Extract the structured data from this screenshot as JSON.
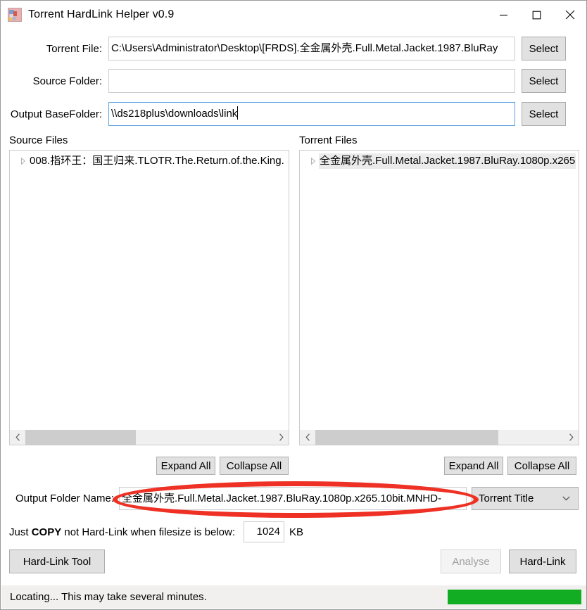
{
  "window": {
    "title": "Torrent HardLink Helper v0.9",
    "icon": "app-icon",
    "controls": {
      "minimize": "minimize-icon",
      "maximize": "maximize-icon",
      "close": "close-icon"
    }
  },
  "form": {
    "torrent_file": {
      "label": "Torrent File:",
      "value": "C:\\Users\\Administrator\\Desktop\\[FRDS].全金属外壳.Full.Metal.Jacket.1987.BluRay",
      "button": "Select"
    },
    "source_folder": {
      "label": "Source Folder:",
      "value": "",
      "button": "Select"
    },
    "output_basefolder": {
      "label": "Output BaseFolder:",
      "value": "\\\\ds218plus\\downloads\\link",
      "button": "Select"
    }
  },
  "panels": {
    "source": {
      "header": "Source Files",
      "items": [
        {
          "label": "008.指环王：国王归来.TLOTR.The.Return.of.the.King.",
          "expander": "chevron-right-icon",
          "selected": false
        }
      ],
      "scroll_left_icon": "chevron-left-icon",
      "scroll_right_icon": "chevron-right-icon",
      "expand_all": "Expand All",
      "collapse_all": "Collapse All"
    },
    "torrent": {
      "header": "Torrent Files",
      "items": [
        {
          "label": "全金属外壳.Full.Metal.Jacket.1987.BluRay.1080p.x265",
          "expander": "chevron-right-icon",
          "selected": true
        }
      ],
      "scroll_left_icon": "chevron-left-icon",
      "scroll_right_icon": "chevron-right-icon",
      "expand_all": "Expand All",
      "collapse_all": "Collapse All"
    }
  },
  "output_folder_name": {
    "label": "Output Folder Name:",
    "value": "全金属外壳.Full.Metal.Jacket.1987.BluRay.1080p.x265.10bit.MNHD-",
    "mode_selected": "Torrent Title",
    "mode_arrow": "chevron-down-icon"
  },
  "copy_threshold": {
    "prefix": "Just ",
    "emphasis": "COPY",
    "suffix": " not Hard-Link when filesize is below:",
    "value": "1024",
    "unit": "KB"
  },
  "actions": {
    "hardlink_tool": "Hard-Link Tool",
    "analyse": "Analyse",
    "hardlink": "Hard-Link"
  },
  "status": {
    "text": "Locating... This may take several minutes.",
    "progress_percent": 100,
    "progress_color": "#12ad22"
  },
  "annotation": {
    "shape": "ellipse",
    "color": "#ee3124",
    "target": "output-folder-name-input"
  }
}
